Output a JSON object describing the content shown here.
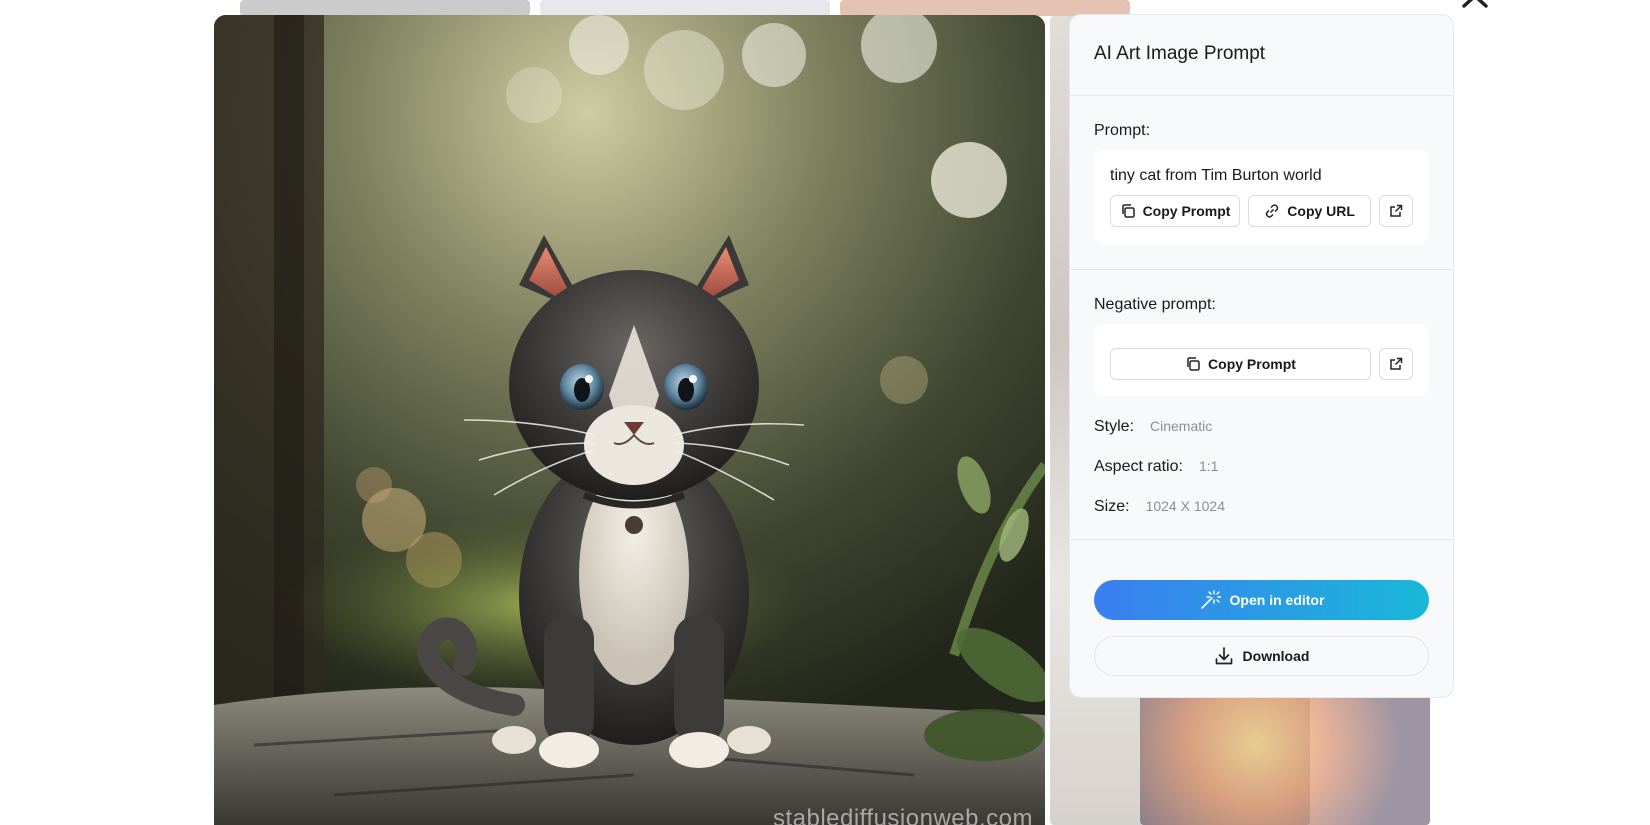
{
  "modal": {
    "close_icon": "close-icon",
    "image": {
      "subject": "tiny kitten sitting on stone path with bokeh background",
      "watermark": "stablediffusionweb.com"
    }
  },
  "panel": {
    "title": "AI Art Image Prompt",
    "prompt": {
      "label": "Prompt:",
      "text": "tiny cat from Tim Burton world",
      "copy_prompt_label": "Copy Prompt",
      "copy_url_label": "Copy URL",
      "open_icon": "external-link-icon"
    },
    "negative_prompt": {
      "label": "Negative prompt:",
      "copy_prompt_label": "Copy Prompt",
      "open_icon": "external-link-icon"
    },
    "meta": {
      "style_key": "Style:",
      "style_val": "Cinematic",
      "aspect_key": "Aspect ratio:",
      "aspect_val": "1:1",
      "size_key": "Size:",
      "size_val": "1024 X 1024"
    },
    "actions": {
      "editor_label": "Open in editor",
      "download_label": "Download"
    }
  },
  "colors": {
    "accent_start": "#3b7ef0",
    "accent_end": "#19b8d8",
    "panel_bg": "#f8f9fa",
    "muted_text": "#8a8f95"
  }
}
